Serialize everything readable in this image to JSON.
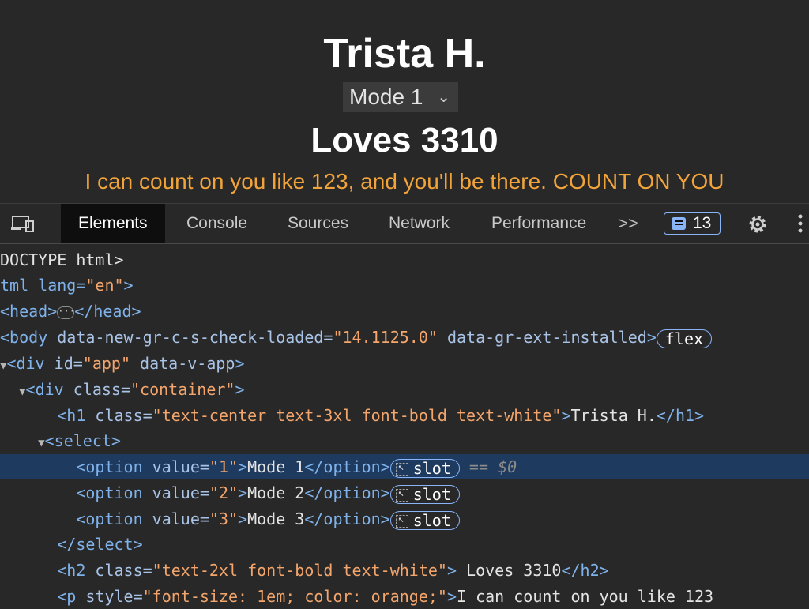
{
  "page": {
    "title": "Trista H.",
    "select_value": "Mode 1",
    "subtitle": "Loves 3310",
    "paragraph": "I can count on you like 123, and you'll be there. COUNT ON YOU"
  },
  "devtools": {
    "tabs": [
      "Elements",
      "Console",
      "Sources",
      "Network",
      "Performance"
    ],
    "more_label": ">>",
    "issues_count": "13",
    "tree": {
      "l1": "DOCTYPE html>",
      "l2_tag": "tml lang=",
      "l2_val": "\"en\"",
      "l3_open": "<head>",
      "l3_close": "</head>",
      "l3_ellipsis": "···",
      "l4_tag": "<body ",
      "l4_attr1": "data-new-gr-c-s-check-loaded=",
      "l4_val1": "\"14.1125.0\"",
      "l4_attr2": " data-gr-ext-installed",
      "l4_close": ">",
      "l4_badge": "flex",
      "l5_tag": "<div ",
      "l5_attr1": "id=",
      "l5_val1": "\"app\"",
      "l5_attr2": " data-v-app",
      "l5_close": ">",
      "l6_tag": "<div ",
      "l6_attr": "class=",
      "l6_val": "\"container\"",
      "l6_close": ">",
      "l7_tag": "<h1 ",
      "l7_attr": "class=",
      "l7_val": "\"text-center text-3xl font-bold text-white\"",
      "l7_gt": ">",
      "l7_text": "Trista H.",
      "l7_end": "</h1>",
      "l8": "<select>",
      "opt_attr": "value=",
      "opt_tag": "<option ",
      "opt_end": "</option>",
      "opt1_val": "\"1\"",
      "opt1_text": "Mode 1",
      "opt2_val": "\"2\"",
      "opt2_text": "Mode 2",
      "opt3_val": "\"3\"",
      "opt3_text": "Mode 3",
      "slot_label": "slot",
      "eq_label": "==",
      "dollar_label": "$0",
      "l12": "</select>",
      "l13_tag": "<h2 ",
      "l13_attr": "class=",
      "l13_val": "\"text-2xl font-bold text-white\"",
      "l13_gt": ">",
      "l13_text": " Loves 3310",
      "l13_end": "</h2>",
      "l14_tag": "<p ",
      "l14_attr": "style=",
      "l14_val": "\"font-size: 1em; color: orange;\"",
      "l14_gt": ">",
      "l14_text": "I can count on you like 123"
    }
  }
}
